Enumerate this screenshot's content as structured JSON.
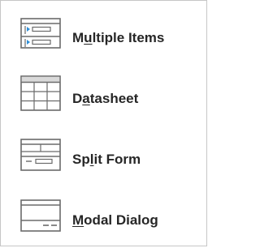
{
  "menu": {
    "items": [
      {
        "id": "multiple-items",
        "before": "M",
        "key": "u",
        "after": "ltiple Items",
        "icon": "multiple-items-form-icon"
      },
      {
        "id": "datasheet",
        "before": "D",
        "key": "a",
        "after": "tasheet",
        "icon": "datasheet-grid-icon"
      },
      {
        "id": "split-form",
        "before": "Sp",
        "key": "l",
        "after": "it Form",
        "icon": "split-form-icon"
      },
      {
        "id": "modal-dialog",
        "before": "",
        "key": "M",
        "after": "odal Dialog",
        "icon": "modal-dialog-icon"
      }
    ]
  },
  "colors": {
    "icon_stroke": "#6b6b6b",
    "icon_accent": "#2f8fd8",
    "text": "#262626",
    "border": "#c6c6c6"
  }
}
